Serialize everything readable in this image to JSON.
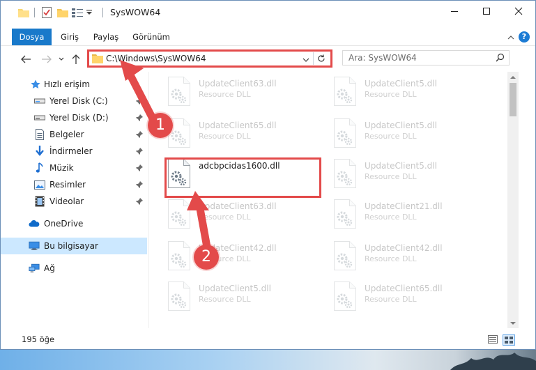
{
  "window": {
    "title": "SysWOW64",
    "controls": {
      "minimize": "minimize-icon",
      "maximize": "maximize-icon",
      "close": "close-icon"
    }
  },
  "ribbon": {
    "tabs": [
      "Dosya",
      "Giriş",
      "Paylaş",
      "Görünüm"
    ],
    "help": "?"
  },
  "nav": {
    "address_path": "C:\\Windows\\SysWOW64",
    "search_placeholder": "Ara: SysWOW64"
  },
  "sidebar": {
    "items": [
      {
        "label": "Hızlı erişim",
        "icon": "star-icon"
      },
      {
        "label": "Yerel Disk (C:)",
        "icon": "drive-icon",
        "pinned": true
      },
      {
        "label": "Yerel Disk (D:)",
        "icon": "drive-icon",
        "pinned": true
      },
      {
        "label": "Belgeler",
        "icon": "documents-icon",
        "pinned": true
      },
      {
        "label": "İndirmeler",
        "icon": "download-icon",
        "pinned": true
      },
      {
        "label": "Müzik",
        "icon": "music-icon",
        "pinned": true
      },
      {
        "label": "Resimler",
        "icon": "pictures-icon",
        "pinned": true
      },
      {
        "label": "Videolar",
        "icon": "videos-icon",
        "pinned": true
      },
      {
        "label": "OneDrive",
        "icon": "cloud-icon"
      },
      {
        "label": "Bu bilgisayar",
        "icon": "computer-icon",
        "selected": true
      },
      {
        "label": "Ağ",
        "icon": "network-icon"
      }
    ]
  },
  "files": {
    "left": [
      {
        "name": "UpdateClient63.dll",
        "type": "Resource DLL"
      },
      {
        "name": "UpdateClient65.dll",
        "type": "Resource DLL"
      },
      {
        "name": "adcbpcidas1600.dll",
        "type": ""
      },
      {
        "name": "UpdateClient63.dll",
        "type": "Resource DLL"
      },
      {
        "name": "UpdateClient42.dll",
        "type": "Resource DLL"
      },
      {
        "name": "UpdateClient5.dll",
        "type": "Resource DLL"
      }
    ],
    "right": [
      {
        "name": "UpdateClient5.dll",
        "type": "Resource DLL"
      },
      {
        "name": "UpdateClient5.dll",
        "type": "Resource DLL"
      },
      {
        "name": "UpdateClient5.dll",
        "type": "Resource DLL"
      },
      {
        "name": "UpdateClient21.dll",
        "type": "Resource DLL"
      },
      {
        "name": "UpdateClient42.dll",
        "type": "Resource DLL"
      },
      {
        "name": "UpdateClient65.dll",
        "type": "Resource DLL"
      }
    ]
  },
  "status": {
    "item_count": "195 öğe"
  },
  "annotations": {
    "badge1": "1",
    "badge2": "2",
    "color": "#e34a4a"
  },
  "colors": {
    "accent": "#1979ca",
    "selected_bg": "#cce8ff",
    "annotation": "#e34a4a"
  }
}
